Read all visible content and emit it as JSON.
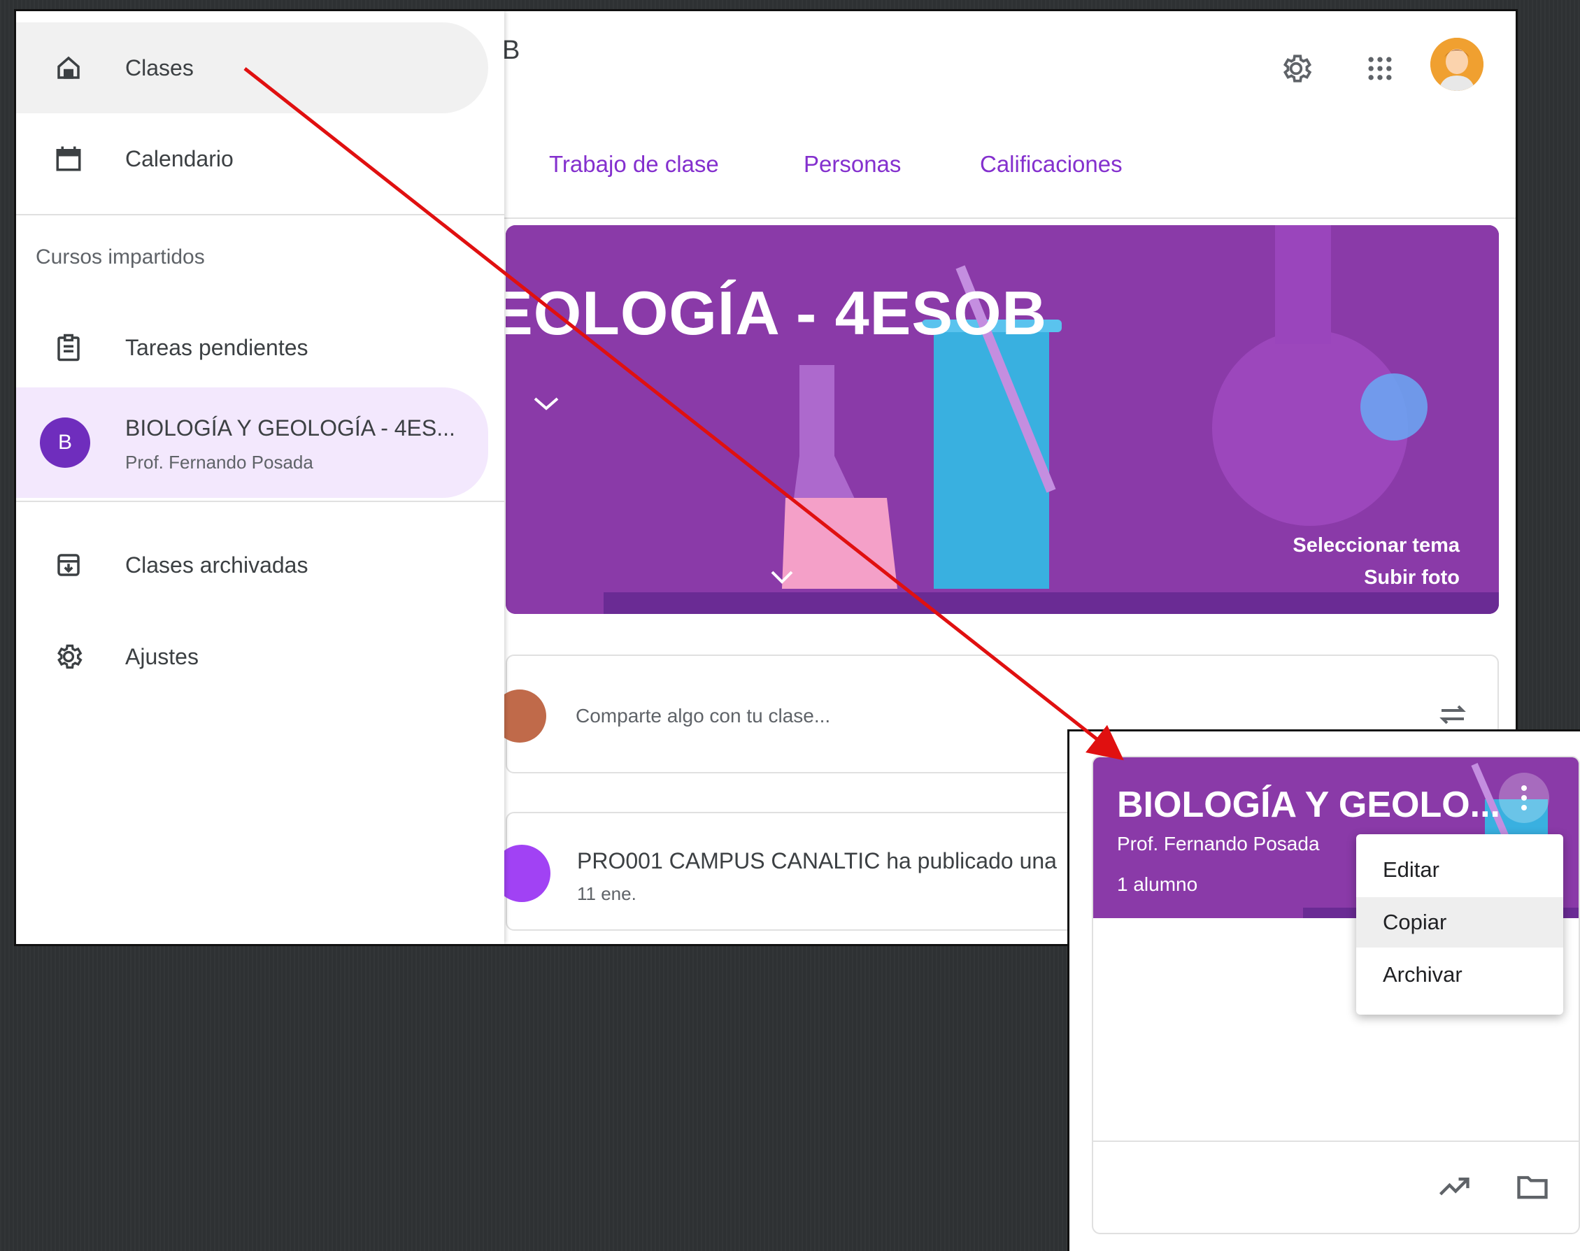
{
  "header": {
    "title_fragment": "B",
    "tabs": [
      "Trabajo de clase",
      "Personas",
      "Calificaciones"
    ]
  },
  "banner": {
    "title": "EOLOGÍA - 4ESOB",
    "select_theme": "Seleccionar tema",
    "upload_photo": "Subir foto"
  },
  "stream": {
    "share_placeholder": "Comparte algo con tu clase...",
    "post_title": "PRO001 CAMPUS CANALTIC ha publicado una",
    "post_date": "11 ene."
  },
  "drawer": {
    "classes": "Clases",
    "calendar": "Calendario",
    "section_taught": "Cursos impartidos",
    "todo": "Tareas pendientes",
    "course": {
      "initial": "B",
      "name": "BIOLOGÍA Y GEOLOGÍA - 4ES...",
      "teacher": "Prof. Fernando Posada"
    },
    "archived": "Clases archivadas",
    "settings": "Ajustes"
  },
  "popup": {
    "card_title": "BIOLOGÍA Y GEOLO...",
    "teacher": "Prof. Fernando Posada",
    "students": "1 alumno",
    "menu": [
      "Editar",
      "Copiar",
      "Archivar"
    ]
  },
  "colors": {
    "accent": "#8430ce",
    "banner": "#8a3aa8",
    "arrow": "#e01010"
  }
}
